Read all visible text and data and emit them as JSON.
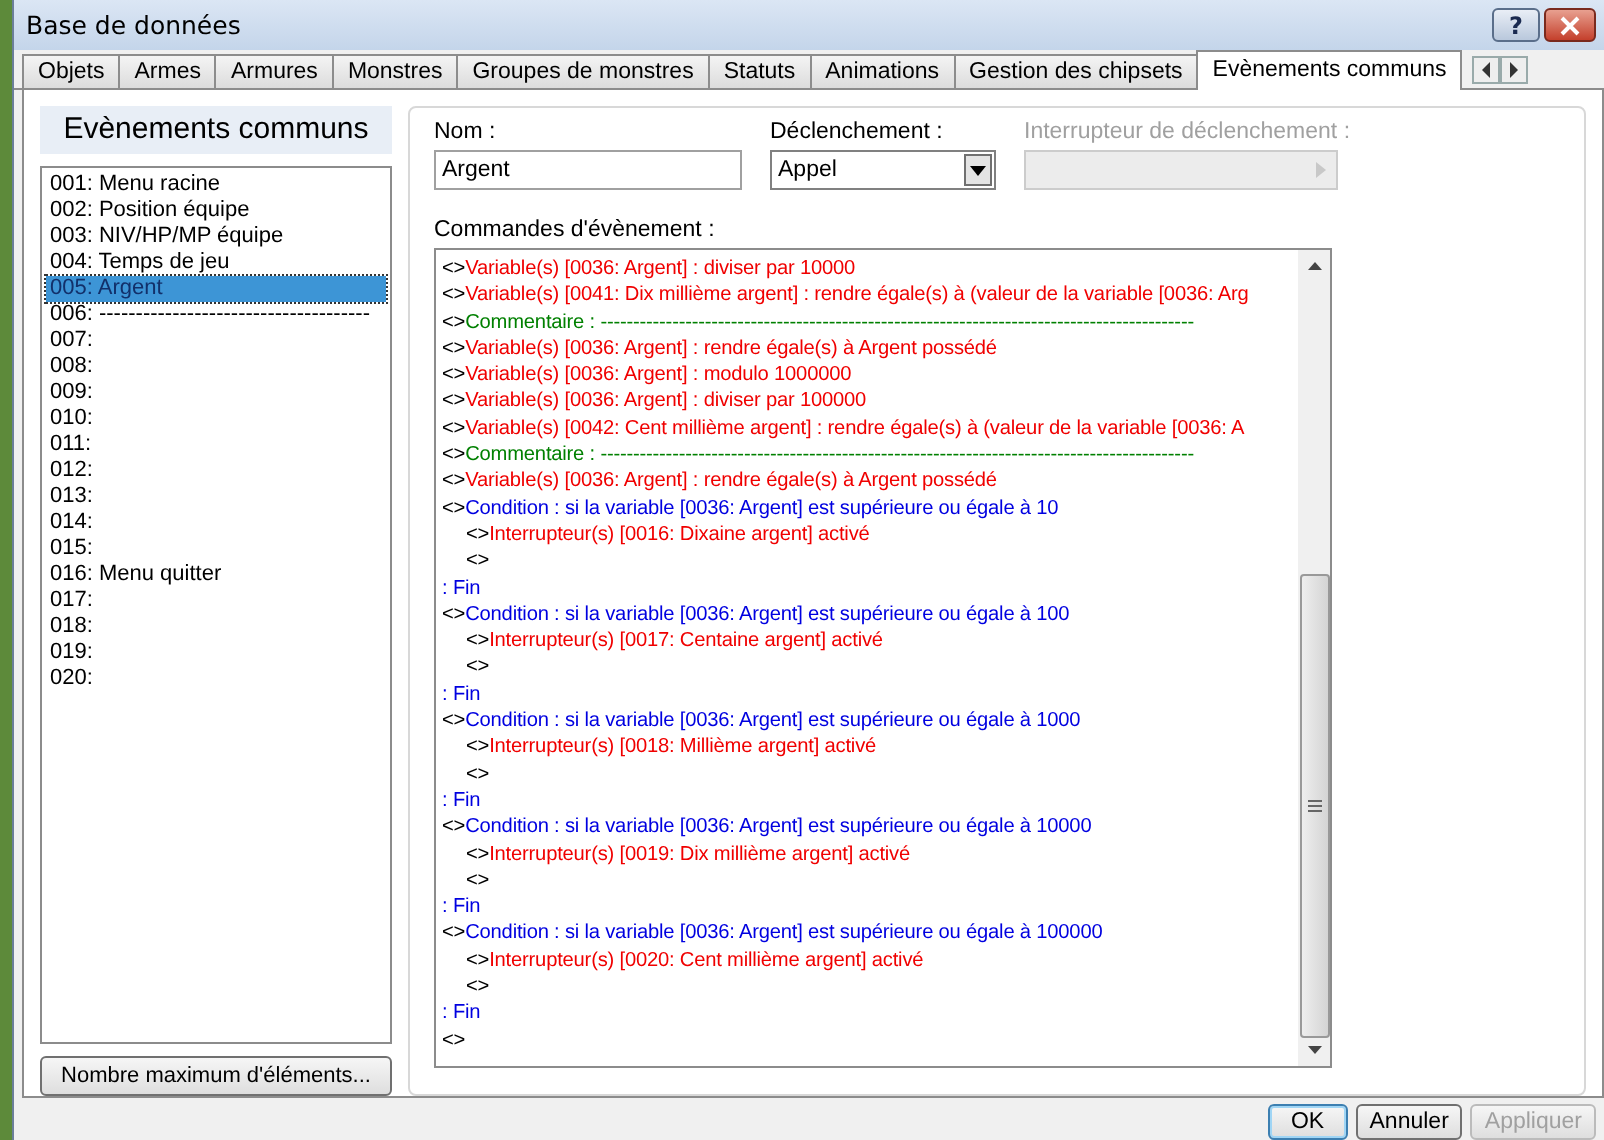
{
  "window": {
    "title": "Base de données"
  },
  "title_buttons": [
    "?"
  ],
  "tabs": [
    {
      "label": "Objets",
      "selected": false
    },
    {
      "label": "Armes",
      "selected": false
    },
    {
      "label": "Armures",
      "selected": false
    },
    {
      "label": "Monstres",
      "selected": false
    },
    {
      "label": "Groupes de monstres",
      "selected": false
    },
    {
      "label": "Statuts",
      "selected": false
    },
    {
      "label": "Animations",
      "selected": false
    },
    {
      "label": "Gestion des chipsets",
      "selected": false
    },
    {
      "label": "Evènements communs",
      "selected": true
    }
  ],
  "sidebar": {
    "title": "Evènements communs",
    "items": [
      {
        "label": "001: Menu racine",
        "selected": false
      },
      {
        "label": "002: Position équipe",
        "selected": false
      },
      {
        "label": "003: NIV/HP/MP équipe",
        "selected": false
      },
      {
        "label": "004: Temps de jeu",
        "selected": false
      },
      {
        "label": "005: Argent",
        "selected": true
      },
      {
        "label": "006: -------------------------------------",
        "selected": false
      },
      {
        "label": "007:",
        "selected": false
      },
      {
        "label": "008:",
        "selected": false
      },
      {
        "label": "009:",
        "selected": false
      },
      {
        "label": "010:",
        "selected": false
      },
      {
        "label": "011:",
        "selected": false
      },
      {
        "label": "012:",
        "selected": false
      },
      {
        "label": "013:",
        "selected": false
      },
      {
        "label": "014:",
        "selected": false
      },
      {
        "label": "015:",
        "selected": false
      },
      {
        "label": "016: Menu quitter",
        "selected": false
      },
      {
        "label": "017:",
        "selected": false
      },
      {
        "label": "018:",
        "selected": false
      },
      {
        "label": "019:",
        "selected": false
      },
      {
        "label": "020:",
        "selected": false
      }
    ],
    "button": "Nombre maximum d'éléments..."
  },
  "name_field": {
    "label": "Nom :",
    "value": "Argent"
  },
  "trigger": {
    "label": "Déclenchement :",
    "value": "Appel"
  },
  "trigger_switch": {
    "label": "Interrupteur de déclenchement :",
    "disabled": true
  },
  "commands": {
    "label": "Commandes d'évènement :",
    "items": [
      {
        "kind": "variable",
        "prefix": "<>",
        "text": "Variable(s) [0036: Argent] : diviser par 10000"
      },
      {
        "kind": "variable",
        "prefix": "<>",
        "text": "Variable(s) [0041: Dix millième argent] : rendre égale(s) à (valeur de la variable [0036: Arg"
      },
      {
        "kind": "comment",
        "prefix": "<>",
        "text": "Commentaire : -------------------------------------------------------------------------------------------"
      },
      {
        "kind": "variable",
        "prefix": "<>",
        "text": "Variable(s) [0036: Argent] : rendre égale(s) à Argent possédé"
      },
      {
        "kind": "variable",
        "prefix": "<>",
        "text": "Variable(s) [0036: Argent] : modulo 1000000"
      },
      {
        "kind": "variable",
        "prefix": "<>",
        "text": "Variable(s) [0036: Argent] : diviser par 100000"
      },
      {
        "kind": "variable",
        "prefix": "<>",
        "text": "Variable(s) [0042: Cent millième argent] : rendre égale(s) à (valeur de la variable [0036: A"
      },
      {
        "kind": "comment",
        "prefix": "<>",
        "text": "Commentaire : -------------------------------------------------------------------------------------------"
      },
      {
        "kind": "variable",
        "prefix": "<>",
        "text": "Variable(s) [0036: Argent] : rendre égale(s) à Argent possédé"
      },
      {
        "kind": "condition",
        "prefix": "<>",
        "text": "Condition : si la variable [0036: Argent] est supérieure ou égale à 10",
        "children": [
          {
            "kind": "switch",
            "prefix": "<>",
            "text": "Interrupteur(s) [0016: Dixaine argent] activé"
          },
          {
            "kind": "empty",
            "prefix": "<>"
          }
        ]
      },
      {
        "kind": "end",
        "prefix": ":",
        "text": "Fin"
      },
      {
        "kind": "condition",
        "prefix": "<>",
        "text": "Condition : si la variable [0036: Argent] est supérieure ou égale à 100",
        "children": [
          {
            "kind": "switch",
            "prefix": "<>",
            "text": "Interrupteur(s) [0017: Centaine argent] activé"
          },
          {
            "kind": "empty",
            "prefix": "<>"
          }
        ]
      },
      {
        "kind": "end",
        "prefix": ":",
        "text": "Fin"
      },
      {
        "kind": "condition",
        "prefix": "<>",
        "text": "Condition : si la variable [0036: Argent] est supérieure ou égale à 1000",
        "children": [
          {
            "kind": "switch",
            "prefix": "<>",
            "text": "Interrupteur(s) [0018: Millième argent] activé"
          },
          {
            "kind": "empty",
            "prefix": "<>"
          }
        ]
      },
      {
        "kind": "end",
        "prefix": ":",
        "text": "Fin"
      },
      {
        "kind": "condition",
        "prefix": "<>",
        "text": "Condition : si la variable [0036: Argent] est supérieure ou égale à 10000",
        "children": [
          {
            "kind": "switch",
            "prefix": "<>",
            "text": "Interrupteur(s) [0019: Dix millième argent] activé"
          },
          {
            "kind": "empty",
            "prefix": "<>"
          }
        ]
      },
      {
        "kind": "end",
        "prefix": ":",
        "text": "Fin"
      },
      {
        "kind": "condition",
        "prefix": "<>",
        "text": "Condition : si la variable [0036: Argent] est supérieure ou égale à 100000",
        "children": [
          {
            "kind": "switch",
            "prefix": "<>",
            "text": "Interrupteur(s) [0020: Cent millième argent] activé"
          },
          {
            "kind": "empty",
            "prefix": "<>"
          }
        ]
      },
      {
        "kind": "end",
        "prefix": ":",
        "text": "Fin"
      },
      {
        "kind": "empty",
        "prefix": "<>"
      }
    ]
  },
  "buttons": [
    {
      "label": "OK",
      "disabled": false,
      "default": true
    },
    {
      "label": "Annuler",
      "disabled": false,
      "default": false
    },
    {
      "label": "Appliquer",
      "disabled": true,
      "default": false
    }
  ]
}
